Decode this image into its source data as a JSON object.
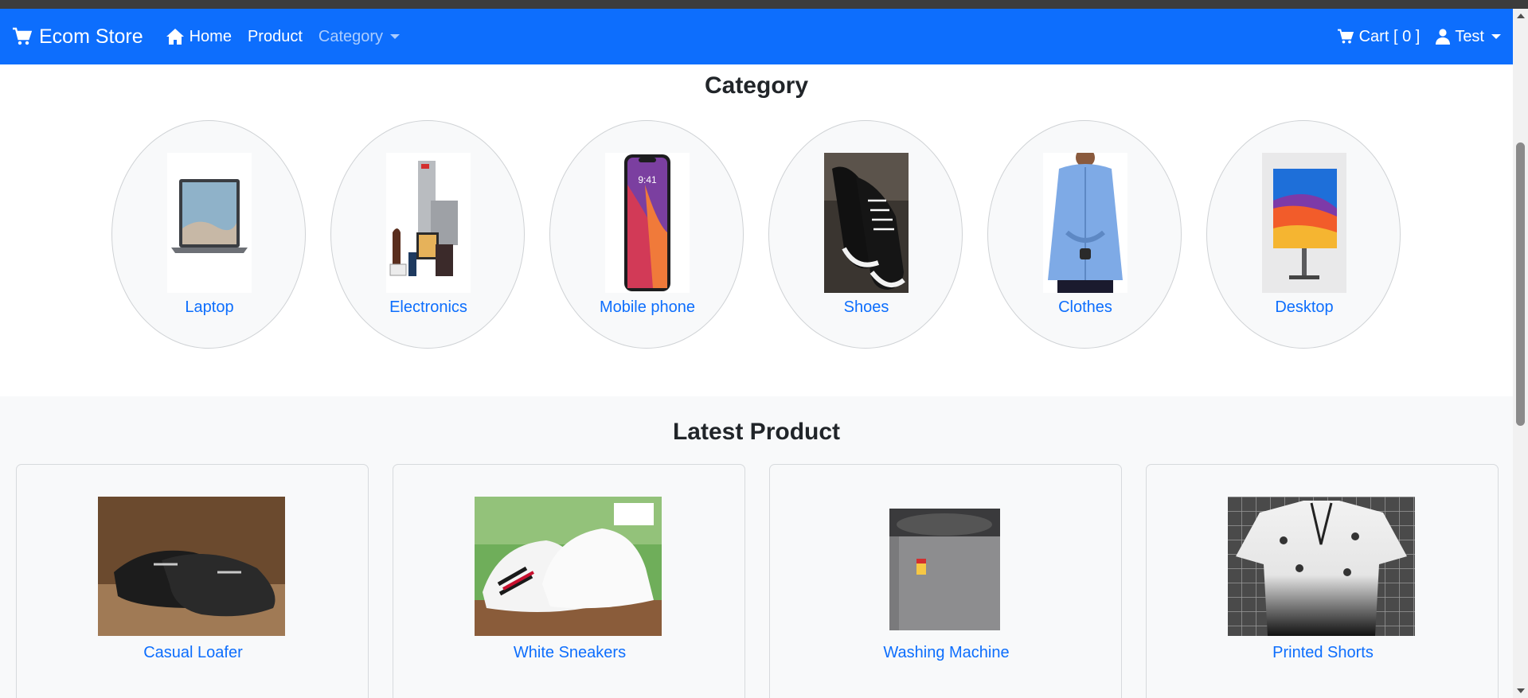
{
  "navbar": {
    "brand": "Ecom Store",
    "home": "Home",
    "product": "Product",
    "category": "Category",
    "cart": "Cart [ 0 ]",
    "user": "Test",
    "bg_color": "#0d6efd"
  },
  "category_section": {
    "title": "Category",
    "items": [
      {
        "label": "Laptop",
        "icon": "laptop-image"
      },
      {
        "label": "Electronics",
        "icon": "electronics-image"
      },
      {
        "label": "Mobile phone",
        "icon": "mobile-phone-image"
      },
      {
        "label": "Shoes",
        "icon": "shoes-image"
      },
      {
        "label": "Clothes",
        "icon": "clothes-image"
      },
      {
        "label": "Desktop",
        "icon": "desktop-image"
      }
    ]
  },
  "latest_section": {
    "title": "Latest Product",
    "items": [
      {
        "label": "Casual Loafer",
        "icon": "loafer-image"
      },
      {
        "label": "White Sneakers",
        "icon": "sneakers-image"
      },
      {
        "label": "Washing Machine",
        "icon": "washing-machine-image"
      },
      {
        "label": "Printed Shorts",
        "icon": "printed-shirt-image"
      }
    ]
  },
  "colors": {
    "link": "#0d6efd",
    "accent": "#0d6efd",
    "section_bg": "#f8f9fa"
  }
}
